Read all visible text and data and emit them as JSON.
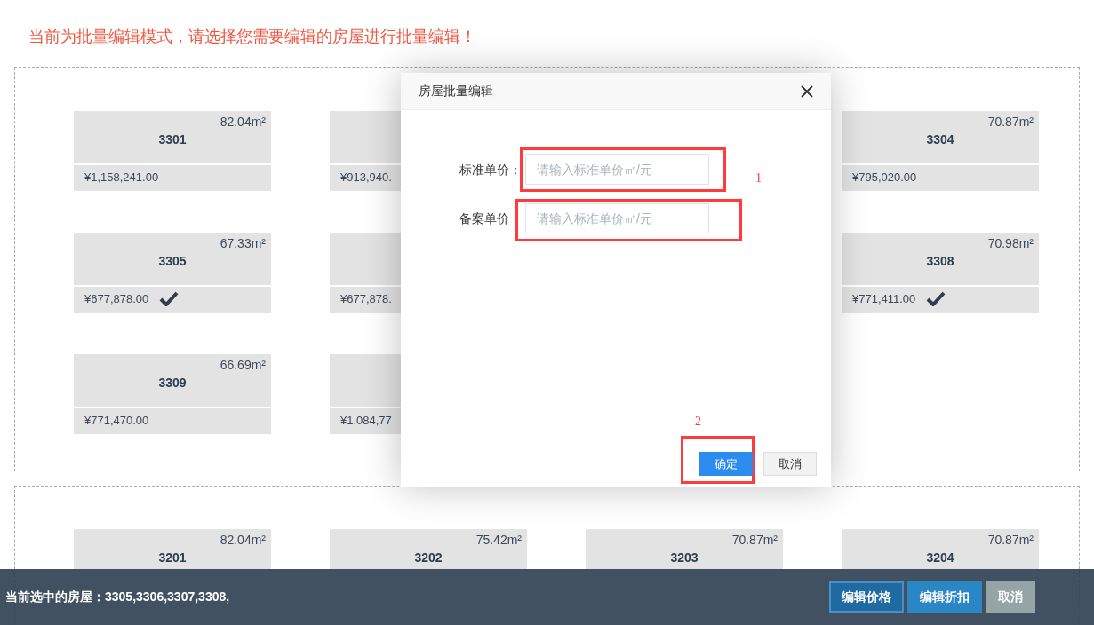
{
  "notice": "当前为批量编辑模式，请选择您需要编辑的房屋进行批量编辑！",
  "sections": [
    {
      "cards": [
        {
          "kind": "full",
          "area": "82.04m²",
          "number": "3301",
          "price": "¥1,158,241.00",
          "selected": false
        },
        {
          "kind": "price_only",
          "price": "¥913,940."
        },
        {
          "kind": "covered"
        },
        {
          "kind": "full",
          "area": "70.87m²",
          "number": "3304",
          "price": "¥795,020.00",
          "selected": false
        },
        {
          "kind": "full",
          "area": "67.33m²",
          "number": "3305",
          "price": "¥677,878.00",
          "selected": true
        },
        {
          "kind": "price_only",
          "price": "¥677,878."
        },
        {
          "kind": "covered"
        },
        {
          "kind": "full",
          "area": "70.98m²",
          "number": "3308",
          "price": "¥771,411.00",
          "selected": true
        },
        {
          "kind": "full",
          "area": "66.69m²",
          "number": "3309",
          "price": "¥771,470.00",
          "selected": false
        },
        {
          "kind": "price_only",
          "price": "¥1,084,77"
        }
      ]
    },
    {
      "cards": [
        {
          "kind": "top_only",
          "area": "82.04m²",
          "number": "3201"
        },
        {
          "kind": "top_only",
          "area": "75.42m²",
          "number": "3202"
        },
        {
          "kind": "top_only",
          "area": "70.87m²",
          "number": "3203"
        },
        {
          "kind": "top_only",
          "area": "70.87m²",
          "number": "3204"
        }
      ]
    }
  ],
  "dialog": {
    "title": "房屋批量编辑",
    "fields": [
      {
        "label": "标准单价：",
        "placeholder": "请输入标准单价㎡/元"
      },
      {
        "label": "备案单价：",
        "placeholder": "请输入标准单价㎡/元"
      }
    ],
    "buttons": [
      {
        "label": "确定",
        "kind": "primary"
      },
      {
        "label": "取消",
        "kind": "default"
      }
    ],
    "annotations": [
      "1",
      "2"
    ]
  },
  "bottom_bar": {
    "selection": "当前选中的房屋：3305,3306,3307,3308,",
    "buttons": [
      {
        "label": "编辑价格",
        "kind": "active"
      },
      {
        "label": "编辑折扣",
        "kind": "primary"
      },
      {
        "label": "取消",
        "kind": "neutral"
      }
    ]
  }
}
